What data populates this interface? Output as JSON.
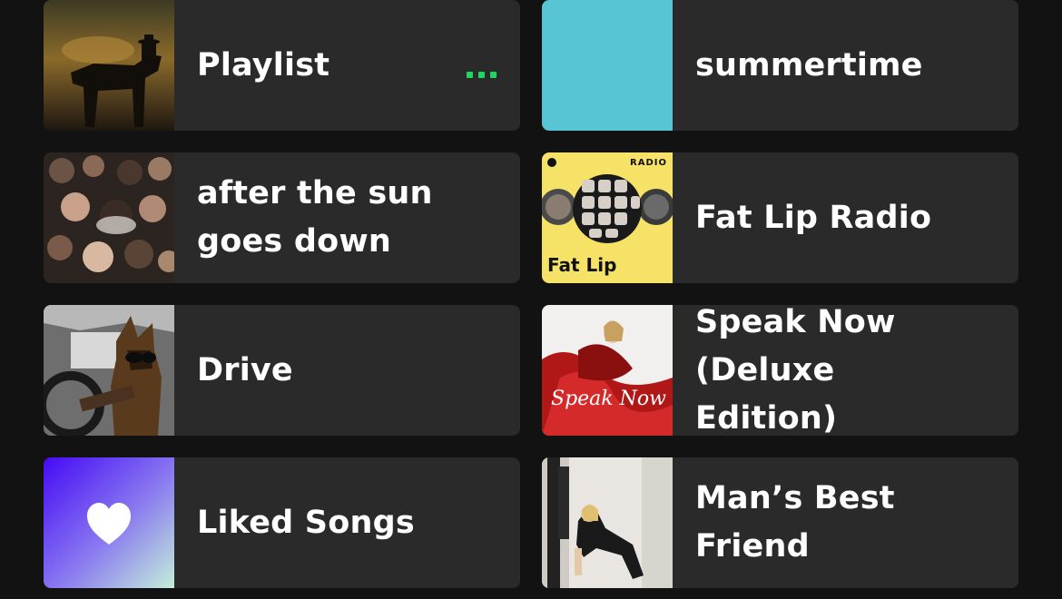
{
  "items": [
    {
      "title": "Playlist",
      "art": "western-rider-art"
    },
    {
      "title": "summertime",
      "art": "teal-solid-art",
      "color": "#57c5d3"
    },
    {
      "title": "after the sun goes down",
      "art": "crowd-photo-art"
    },
    {
      "title": "Fat Lip Radio",
      "art": "radio-collage-art",
      "radio_tag": "RADIO",
      "radio_title": "Fat Lip",
      "color": "#f5e266"
    },
    {
      "title": "Drive",
      "art": "dog-driving-art"
    },
    {
      "title": "Speak Now (Deluxe Edition)",
      "art": "speak-now-cover-art"
    },
    {
      "title": "Liked Songs",
      "art": "heart-gradient-art",
      "icon": "heart-icon"
    },
    {
      "title": "Man’s Best Friend",
      "art": "album-cover-art"
    }
  ],
  "playing_indicator": {
    "icon": "more-dots-icon",
    "color": "#1ed760"
  }
}
